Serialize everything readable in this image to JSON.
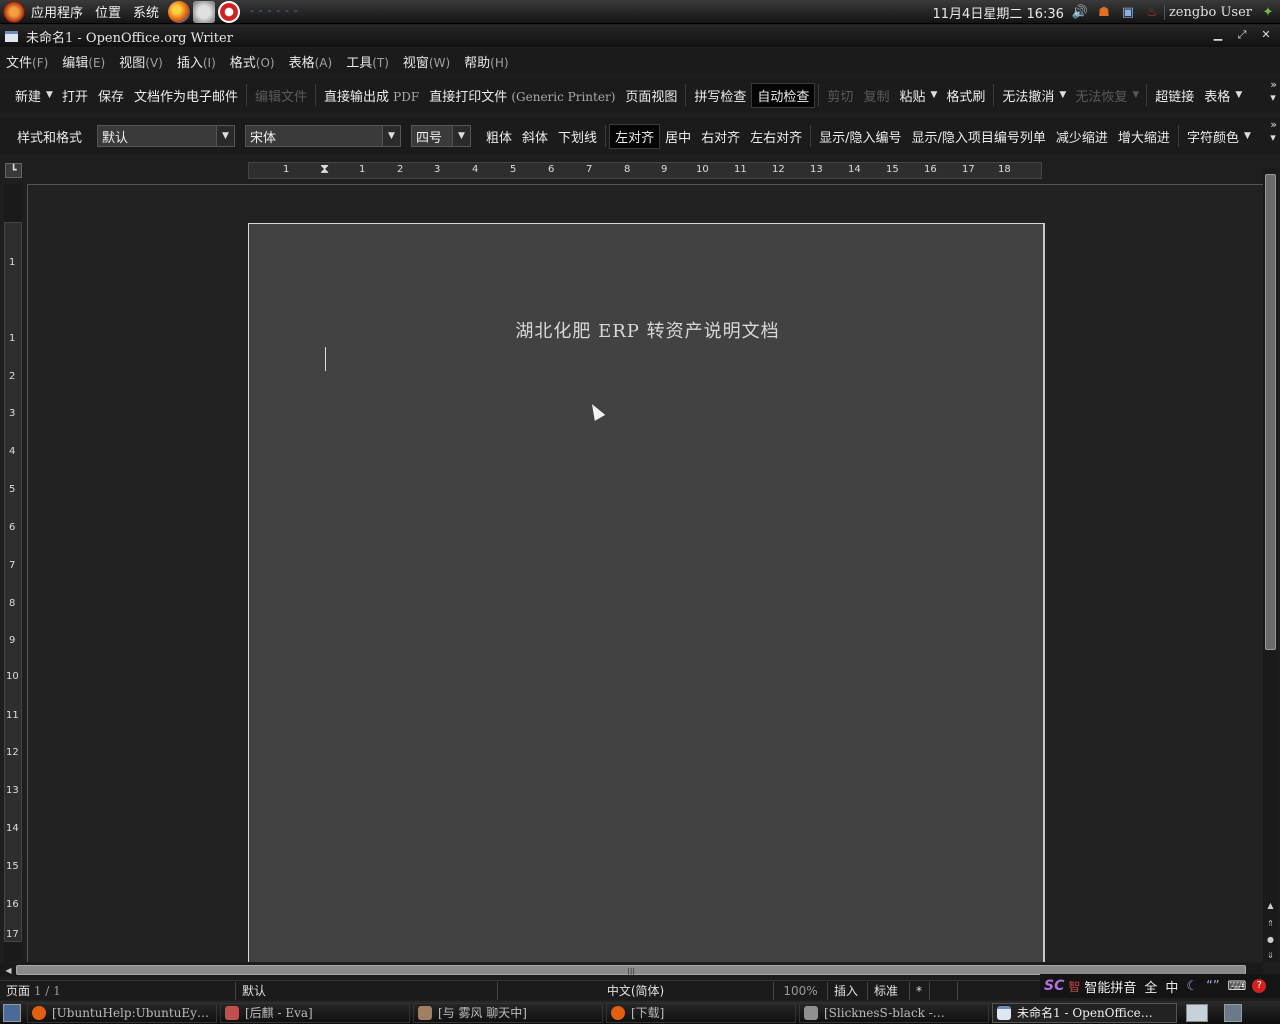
{
  "top_panel": {
    "menus": [
      "应用程序",
      "位置",
      "系统"
    ],
    "clock": "11月4日星期二 16:36",
    "user": "zengbo User"
  },
  "window": {
    "title": "未命名1 - OpenOffice.org Writer"
  },
  "menu": [
    {
      "label": "文件",
      "acc": "(F)"
    },
    {
      "label": "编辑",
      "acc": "(E)"
    },
    {
      "label": "视图",
      "acc": "(V)"
    },
    {
      "label": "插入",
      "acc": "(I)"
    },
    {
      "label": "格式",
      "acc": "(O)"
    },
    {
      "label": "表格",
      "acc": "(A)"
    },
    {
      "label": "工具",
      "acc": "(T)"
    },
    {
      "label": "视窗",
      "acc": "(W)"
    },
    {
      "label": "帮助",
      "acc": "(H)"
    }
  ],
  "toolbar1": {
    "new": "新建",
    "open": "打开",
    "save": "保存",
    "email": "文档作为电子邮件",
    "edit_file": "编辑文件",
    "export_pdf": "直接输出成",
    "export_pdf_en": "PDF",
    "print": "直接打印文件",
    "print_en": "(Generic Printer)",
    "page_view": "页面视图",
    "spellcheck": "拼写检查",
    "autocheck": "自动检查",
    "cut": "剪切",
    "copy": "复制",
    "paste": "粘贴",
    "format_paint": "格式刷",
    "undo": "无法撤消",
    "redo": "无法恢复",
    "hyperlink": "超链接",
    "table": "表格"
  },
  "toolbar2": {
    "styles": "样式和格式",
    "style_value": "默认",
    "font_value": "宋体",
    "size_value": "四号",
    "bold": "粗体",
    "italic": "斜体",
    "underline": "下划线",
    "align_left": "左对齐",
    "center": "居中",
    "align_right": "右对齐",
    "justify": "左右对齐",
    "numbering": "显示/隐入编号",
    "bullets": "显示/隐入项目编号列单",
    "decrease_indent": "减少缩进",
    "increase_indent": "增大缩进",
    "font_color": "字符颜色"
  },
  "ruler": {
    "h_labels": [
      "1",
      "1",
      "2",
      "3",
      "4",
      "5",
      "6",
      "7",
      "8",
      "9",
      "10",
      "11",
      "12",
      "13",
      "14",
      "15",
      "16",
      "17",
      "18"
    ],
    "v_labels": [
      "1",
      "1",
      "2",
      "3",
      "4",
      "5",
      "6",
      "7",
      "8",
      "9",
      "10",
      "11",
      "12",
      "13",
      "14",
      "15",
      "16",
      "17"
    ]
  },
  "document": {
    "heading": "湖北化肥 ERP 转资产说明文档"
  },
  "status": {
    "page": "页面",
    "page_en": "1 / 1",
    "style": "默认",
    "language": "中文(简体)",
    "zoom": "100%",
    "insert": "插入",
    "selection": "标准",
    "modified": "*"
  },
  "ime": {
    "name": "智能拼音",
    "full": "全",
    "zh": "中"
  },
  "taskbar": [
    {
      "label": "[UbuntuHelp:UbuntuEy…",
      "color": "#e06010"
    },
    {
      "label": "[后麒 - Eva]",
      "color": "#c05050"
    },
    {
      "label": "[与 雾风 聊天中]",
      "color": "#a08060"
    },
    {
      "label": "[下载]",
      "color": "#e06010"
    },
    {
      "label": "[SlicknesS-black -…",
      "color": "#909090"
    },
    {
      "label": "未命名1 - OpenOffice…",
      "color": "#dfe6ef"
    }
  ]
}
